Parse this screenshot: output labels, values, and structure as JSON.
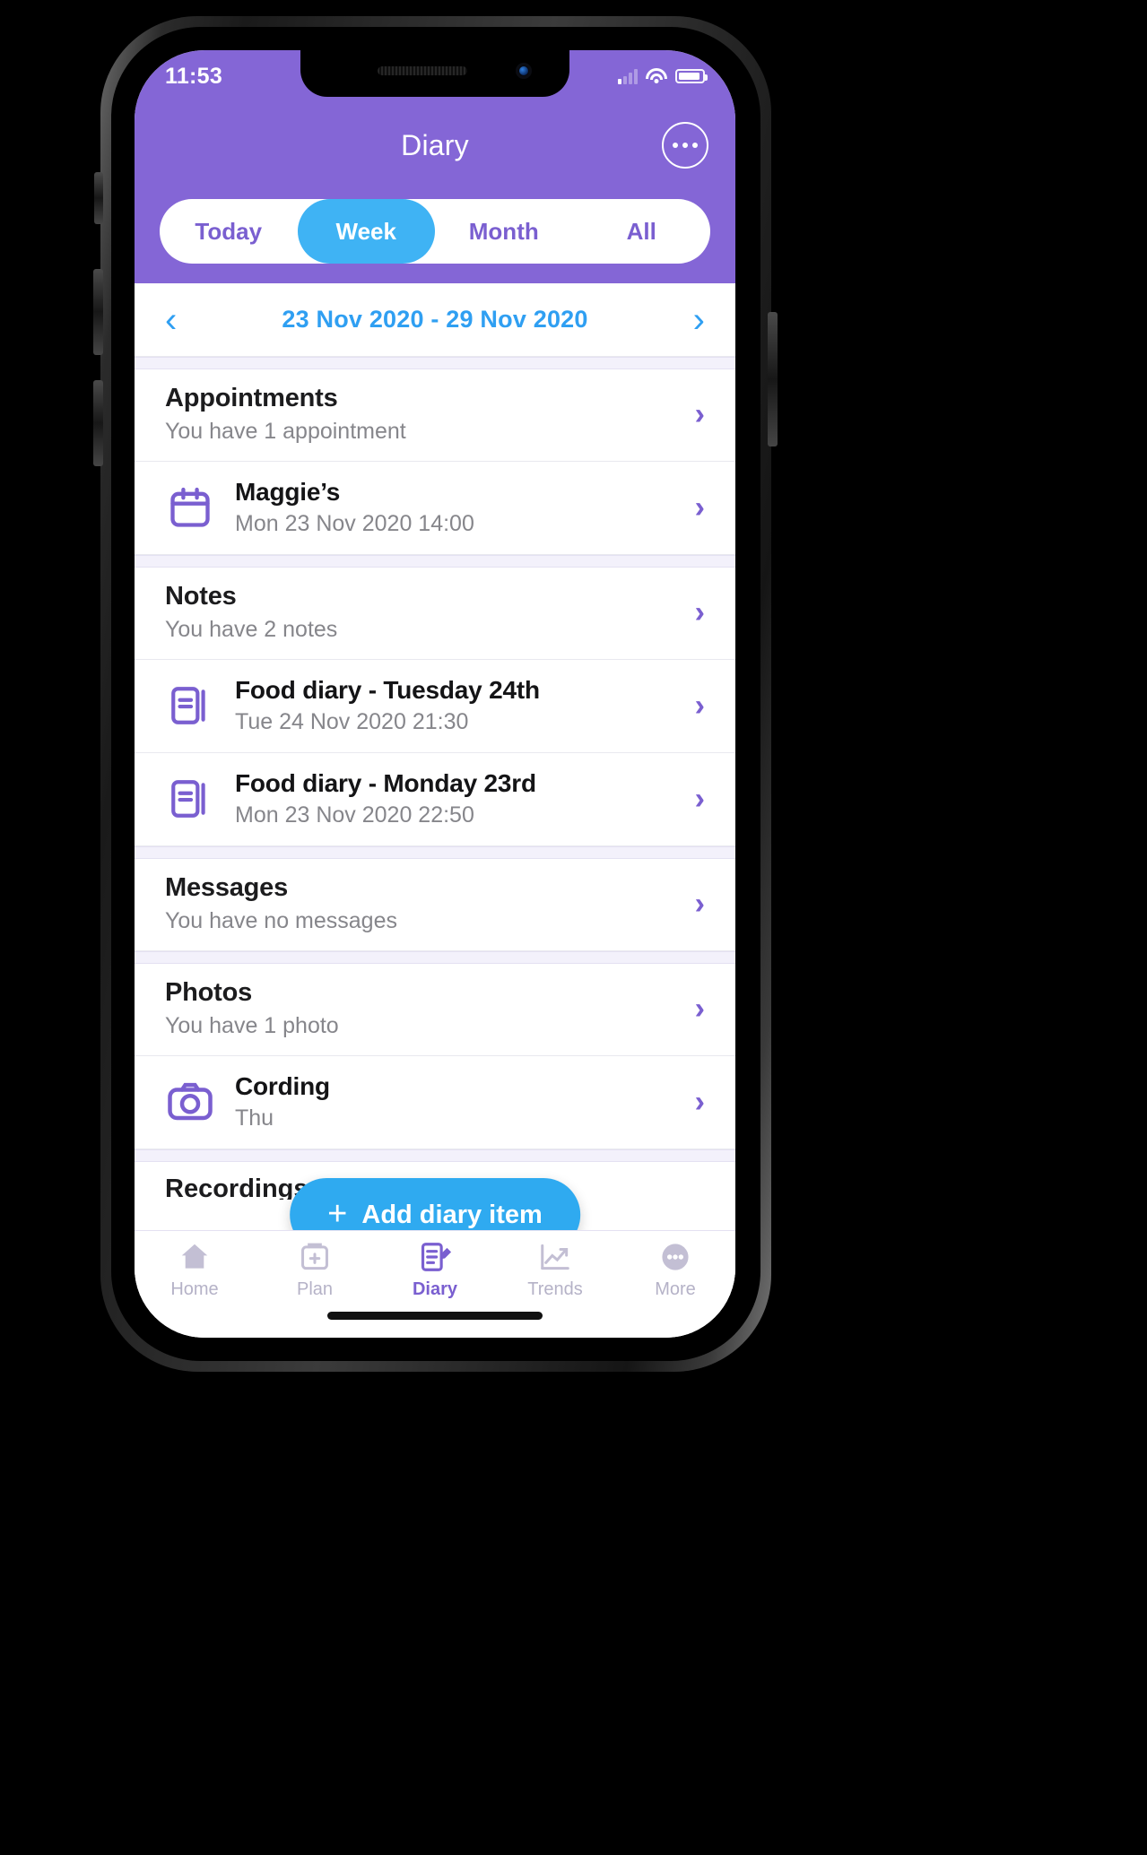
{
  "colors": {
    "header_purple": "#8466d6",
    "accent_blue": "#2faaf0",
    "icon_purple": "#7a5fd0",
    "date_blue": "#2f9ff2"
  },
  "status_bar": {
    "time": "11:53",
    "signal_icon": "cellular-signal-icon",
    "wifi_icon": "wifi-icon",
    "battery_icon": "battery-icon"
  },
  "header": {
    "title": "Diary",
    "more_button_label": "More options"
  },
  "segmented_control": {
    "options": [
      {
        "label": "Today",
        "active": false
      },
      {
        "label": "Week",
        "active": true
      },
      {
        "label": "Month",
        "active": false
      },
      {
        "label": "All",
        "active": false
      }
    ]
  },
  "date_nav": {
    "prev_label": "‹",
    "range": "23 Nov 2020 - 29 Nov 2020",
    "next_label": "›"
  },
  "sections": [
    {
      "title": "Appointments",
      "subtitle": "You have 1 appointment",
      "items": [
        {
          "icon": "calendar-icon",
          "title": "Maggie’s",
          "meta": "Mon 23 Nov 2020 14:00"
        }
      ]
    },
    {
      "title": "Notes",
      "subtitle": "You have 2 notes",
      "items": [
        {
          "icon": "note-icon",
          "title": "Food diary - Tuesday 24th",
          "meta": "Tue 24 Nov 2020 21:30"
        },
        {
          "icon": "note-icon",
          "title": "Food diary - Monday 23rd",
          "meta": "Mon 23 Nov 2020 22:50"
        }
      ]
    },
    {
      "title": "Messages",
      "subtitle": "You have no messages",
      "items": []
    },
    {
      "title": "Photos",
      "subtitle": "You have 1 photo",
      "items": [
        {
          "icon": "camera-icon",
          "title": "Cording",
          "meta": "Thu"
        }
      ]
    }
  ],
  "partial_section": {
    "title": "Recordings"
  },
  "fab": {
    "plus": "+",
    "label": "Add diary item"
  },
  "tabbar": {
    "items": [
      {
        "label": "Home",
        "icon": "home-icon",
        "active": false
      },
      {
        "label": "Plan",
        "icon": "plan-icon",
        "active": false
      },
      {
        "label": "Diary",
        "icon": "diary-icon",
        "active": true
      },
      {
        "label": "Trends",
        "icon": "trends-icon",
        "active": false
      },
      {
        "label": "More",
        "icon": "more-icon",
        "active": false
      }
    ]
  }
}
